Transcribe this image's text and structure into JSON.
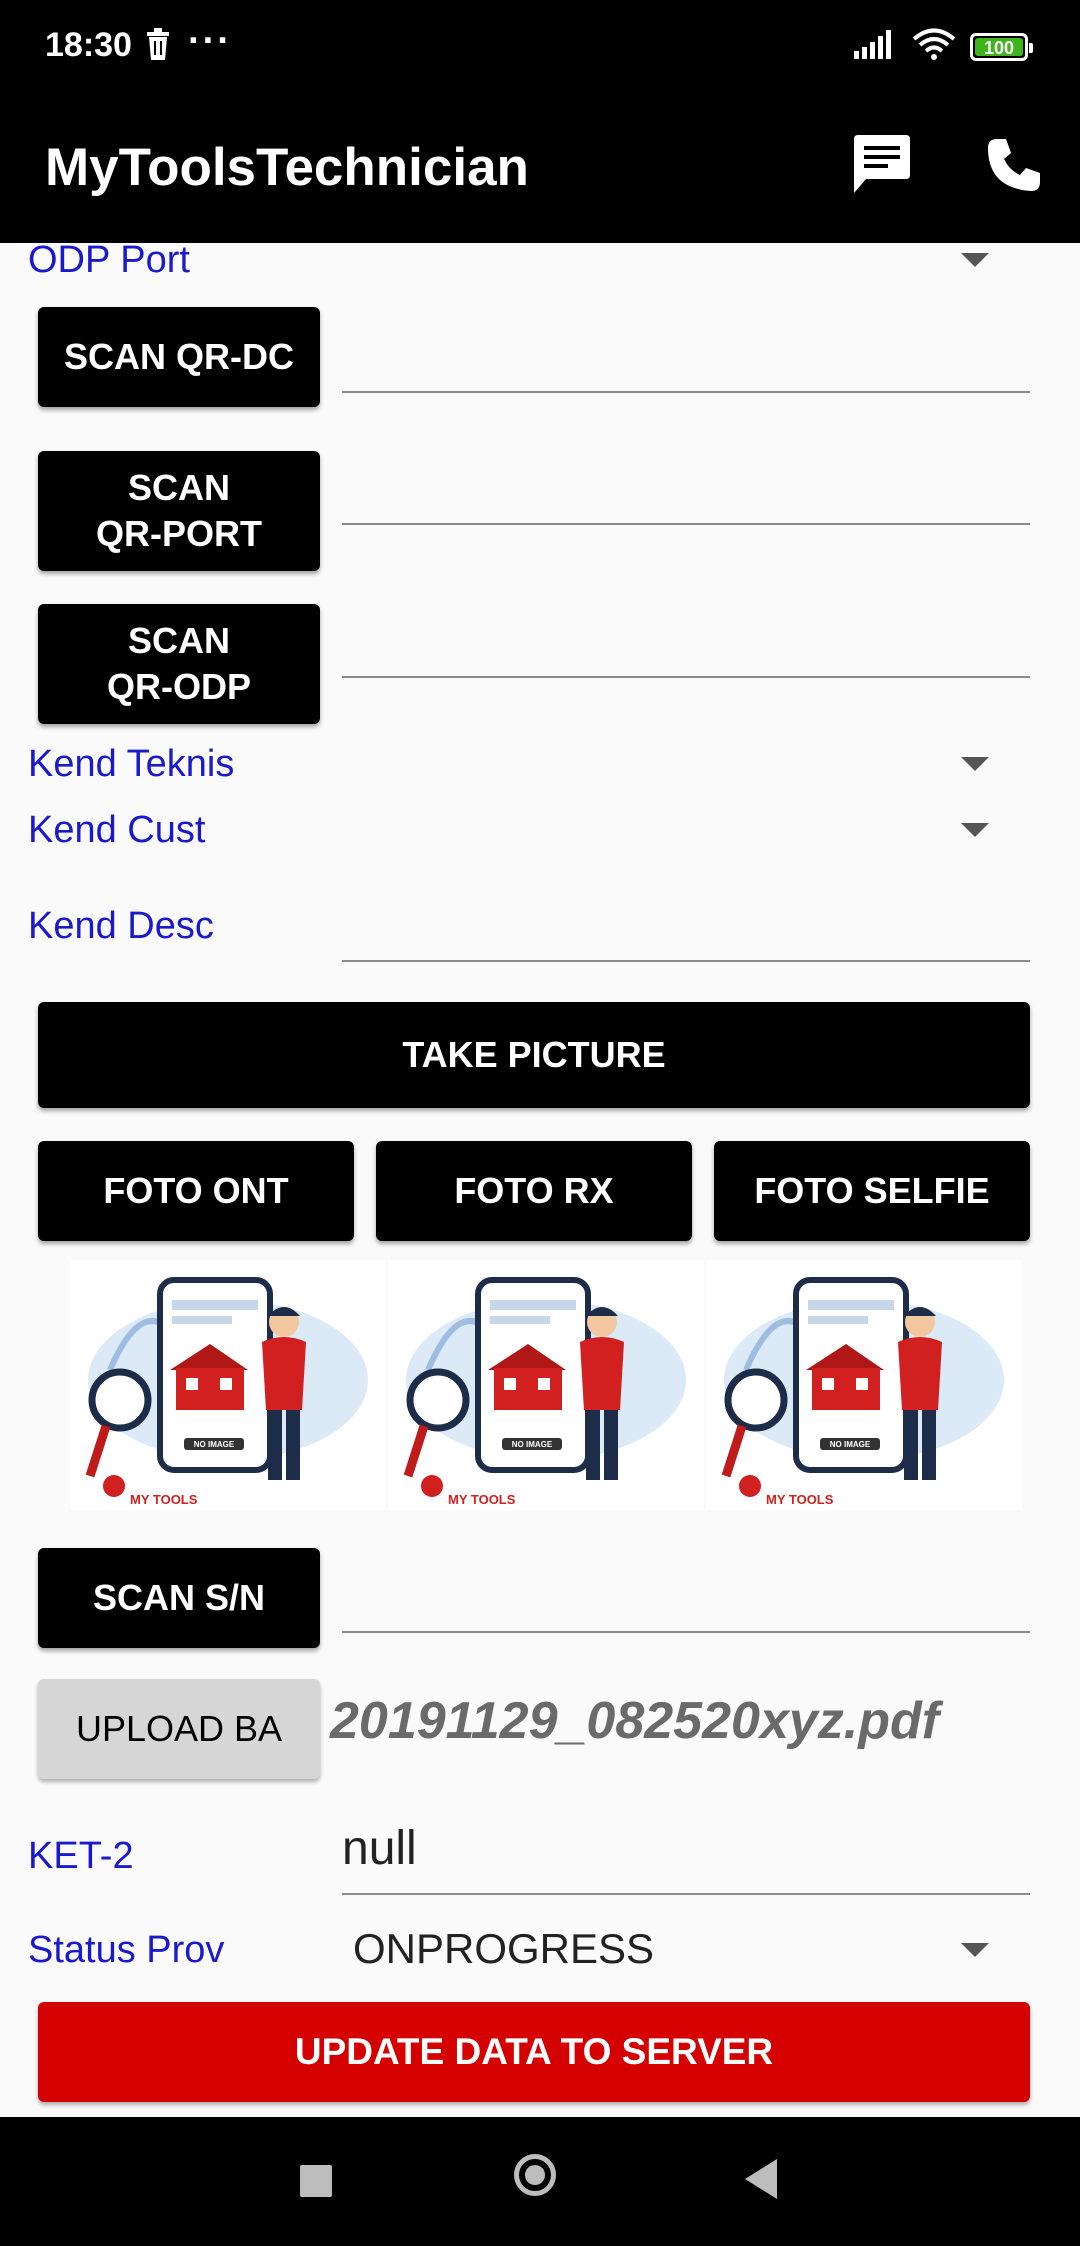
{
  "status_bar": {
    "time": "18:30",
    "dots": "···",
    "battery": "100"
  },
  "app_bar": {
    "title": "MyToolsTechnician"
  },
  "form": {
    "odp_port_label": "ODP Port",
    "scan_qr_dc": "SCAN QR-DC",
    "scan_qr_port": "SCAN\nQR-PORT",
    "scan_qr_odp": "SCAN\nQR-ODP",
    "kend_teknis_label": "Kend Teknis",
    "kend_cust_label": "Kend Cust",
    "kend_desc_label": "Kend Desc",
    "take_picture": "TAKE PICTURE",
    "foto_ont": "FOTO ONT",
    "foto_rx": "FOTO RX",
    "foto_selfie": "FOTO SELFIE",
    "placeholder_no_image": "NO IMAGE",
    "placeholder_brand": "MY TOOLS",
    "scan_sn": "SCAN S/N",
    "upload_ba": "UPLOAD BA",
    "file_name": "20191129_082520xyz.pdf",
    "ket2_label": "KET-2",
    "ket2_value": "null",
    "status_prov_label": "Status Prov",
    "status_prov_value": "ONPROGRESS",
    "update_button": "UPDATE DATA TO SERVER"
  },
  "colors": {
    "label_blue": "#1a1acc",
    "update_red": "#d50000",
    "accent_red": "#d21f1f"
  }
}
